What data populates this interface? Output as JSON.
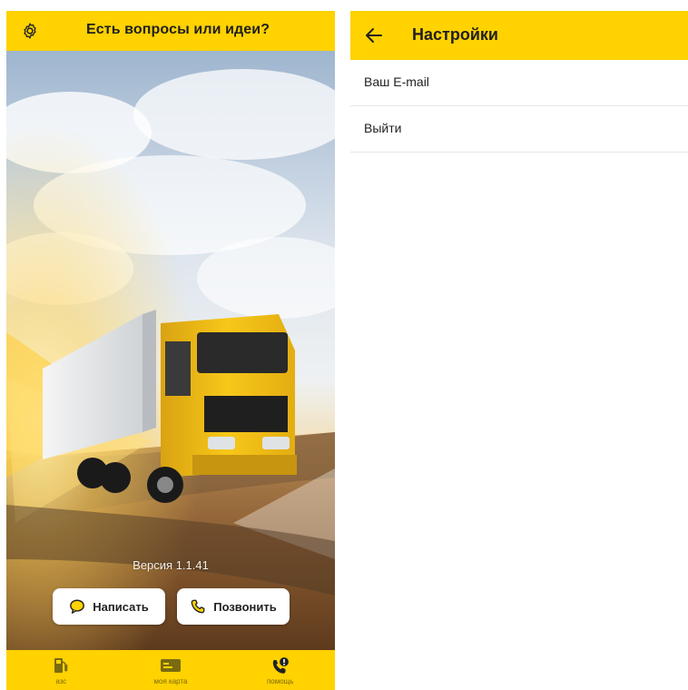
{
  "left": {
    "header": {
      "title": "Есть вопросы или идеи?",
      "settings_icon": "gear-icon"
    },
    "version_text": "Версия 1.1.41",
    "buttons": {
      "write": {
        "label": "Написать",
        "icon": "chat-bubble-icon"
      },
      "call": {
        "label": "Позвонить",
        "icon": "phone-icon"
      }
    },
    "bottom_nav": [
      {
        "label": "азс",
        "icon": "fuel-pump-icon"
      },
      {
        "label": "моя карта",
        "icon": "card-icon"
      },
      {
        "label": "помощь",
        "icon": "help-phone-icon"
      }
    ],
    "colors": {
      "accent": "#ffd200"
    }
  },
  "right": {
    "header": {
      "title": "Настройки",
      "back_icon": "back-arrow-icon"
    },
    "items": [
      {
        "label": "Ваш E-mail"
      },
      {
        "label": "Выйти"
      }
    ]
  }
}
